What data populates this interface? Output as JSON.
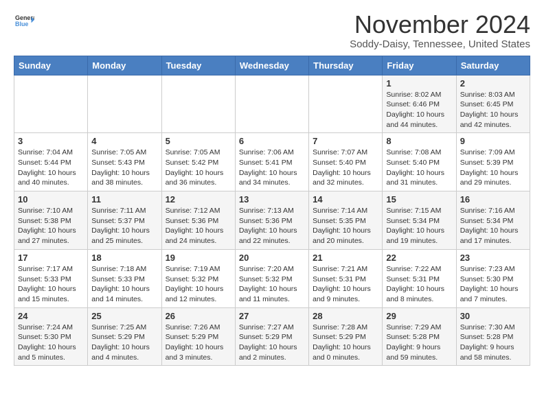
{
  "header": {
    "logo_line1": "General",
    "logo_line2": "Blue",
    "month": "November 2024",
    "location": "Soddy-Daisy, Tennessee, United States"
  },
  "weekdays": [
    "Sunday",
    "Monday",
    "Tuesday",
    "Wednesday",
    "Thursday",
    "Friday",
    "Saturday"
  ],
  "weeks": [
    [
      {
        "day": "",
        "info": ""
      },
      {
        "day": "",
        "info": ""
      },
      {
        "day": "",
        "info": ""
      },
      {
        "day": "",
        "info": ""
      },
      {
        "day": "",
        "info": ""
      },
      {
        "day": "1",
        "info": "Sunrise: 8:02 AM\nSunset: 6:46 PM\nDaylight: 10 hours\nand 44 minutes."
      },
      {
        "day": "2",
        "info": "Sunrise: 8:03 AM\nSunset: 6:45 PM\nDaylight: 10 hours\nand 42 minutes."
      }
    ],
    [
      {
        "day": "3",
        "info": "Sunrise: 7:04 AM\nSunset: 5:44 PM\nDaylight: 10 hours\nand 40 minutes."
      },
      {
        "day": "4",
        "info": "Sunrise: 7:05 AM\nSunset: 5:43 PM\nDaylight: 10 hours\nand 38 minutes."
      },
      {
        "day": "5",
        "info": "Sunrise: 7:05 AM\nSunset: 5:42 PM\nDaylight: 10 hours\nand 36 minutes."
      },
      {
        "day": "6",
        "info": "Sunrise: 7:06 AM\nSunset: 5:41 PM\nDaylight: 10 hours\nand 34 minutes."
      },
      {
        "day": "7",
        "info": "Sunrise: 7:07 AM\nSunset: 5:40 PM\nDaylight: 10 hours\nand 32 minutes."
      },
      {
        "day": "8",
        "info": "Sunrise: 7:08 AM\nSunset: 5:40 PM\nDaylight: 10 hours\nand 31 minutes."
      },
      {
        "day": "9",
        "info": "Sunrise: 7:09 AM\nSunset: 5:39 PM\nDaylight: 10 hours\nand 29 minutes."
      }
    ],
    [
      {
        "day": "10",
        "info": "Sunrise: 7:10 AM\nSunset: 5:38 PM\nDaylight: 10 hours\nand 27 minutes."
      },
      {
        "day": "11",
        "info": "Sunrise: 7:11 AM\nSunset: 5:37 PM\nDaylight: 10 hours\nand 25 minutes."
      },
      {
        "day": "12",
        "info": "Sunrise: 7:12 AM\nSunset: 5:36 PM\nDaylight: 10 hours\nand 24 minutes."
      },
      {
        "day": "13",
        "info": "Sunrise: 7:13 AM\nSunset: 5:36 PM\nDaylight: 10 hours\nand 22 minutes."
      },
      {
        "day": "14",
        "info": "Sunrise: 7:14 AM\nSunset: 5:35 PM\nDaylight: 10 hours\nand 20 minutes."
      },
      {
        "day": "15",
        "info": "Sunrise: 7:15 AM\nSunset: 5:34 PM\nDaylight: 10 hours\nand 19 minutes."
      },
      {
        "day": "16",
        "info": "Sunrise: 7:16 AM\nSunset: 5:34 PM\nDaylight: 10 hours\nand 17 minutes."
      }
    ],
    [
      {
        "day": "17",
        "info": "Sunrise: 7:17 AM\nSunset: 5:33 PM\nDaylight: 10 hours\nand 15 minutes."
      },
      {
        "day": "18",
        "info": "Sunrise: 7:18 AM\nSunset: 5:33 PM\nDaylight: 10 hours\nand 14 minutes."
      },
      {
        "day": "19",
        "info": "Sunrise: 7:19 AM\nSunset: 5:32 PM\nDaylight: 10 hours\nand 12 minutes."
      },
      {
        "day": "20",
        "info": "Sunrise: 7:20 AM\nSunset: 5:32 PM\nDaylight: 10 hours\nand 11 minutes."
      },
      {
        "day": "21",
        "info": "Sunrise: 7:21 AM\nSunset: 5:31 PM\nDaylight: 10 hours\nand 9 minutes."
      },
      {
        "day": "22",
        "info": "Sunrise: 7:22 AM\nSunset: 5:31 PM\nDaylight: 10 hours\nand 8 minutes."
      },
      {
        "day": "23",
        "info": "Sunrise: 7:23 AM\nSunset: 5:30 PM\nDaylight: 10 hours\nand 7 minutes."
      }
    ],
    [
      {
        "day": "24",
        "info": "Sunrise: 7:24 AM\nSunset: 5:30 PM\nDaylight: 10 hours\nand 5 minutes."
      },
      {
        "day": "25",
        "info": "Sunrise: 7:25 AM\nSunset: 5:29 PM\nDaylight: 10 hours\nand 4 minutes."
      },
      {
        "day": "26",
        "info": "Sunrise: 7:26 AM\nSunset: 5:29 PM\nDaylight: 10 hours\nand 3 minutes."
      },
      {
        "day": "27",
        "info": "Sunrise: 7:27 AM\nSunset: 5:29 PM\nDaylight: 10 hours\nand 2 minutes."
      },
      {
        "day": "28",
        "info": "Sunrise: 7:28 AM\nSunset: 5:29 PM\nDaylight: 10 hours\nand 0 minutes."
      },
      {
        "day": "29",
        "info": "Sunrise: 7:29 AM\nSunset: 5:28 PM\nDaylight: 9 hours\nand 59 minutes."
      },
      {
        "day": "30",
        "info": "Sunrise: 7:30 AM\nSunset: 5:28 PM\nDaylight: 9 hours\nand 58 minutes."
      }
    ]
  ]
}
